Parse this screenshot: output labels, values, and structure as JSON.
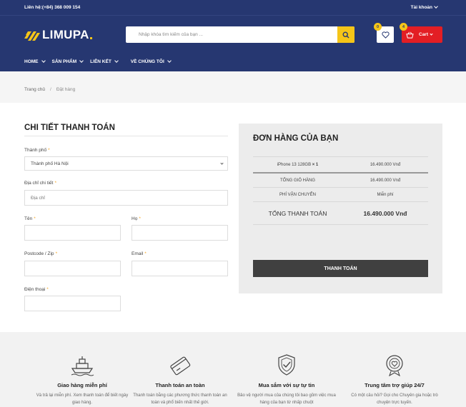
{
  "topbar": {
    "contact": "Liên hệ:(+84) 368 009 154",
    "account": "Tài khoản"
  },
  "header": {
    "logo_text": "LIMUPA",
    "search_placeholder": "Nhập khóa tìm kiếm của bạn ...",
    "wishlist_count": "0",
    "cart_count": "4",
    "cart_label": "Cart"
  },
  "nav": {
    "items": [
      {
        "label": "HOME"
      },
      {
        "label": "SẢN PHẨM"
      },
      {
        "label": "LIÊN KẾT"
      },
      {
        "label": "VỀ CHÚNG TÔI"
      }
    ]
  },
  "breadcrumb": {
    "home": "Trang chủ",
    "separator": "/",
    "current": "Đặt hàng"
  },
  "billing": {
    "title": "CHI TIẾT THANH TOÁN",
    "required_mark": "*",
    "city_label": "Thành phố",
    "city_value": "Thành phố Hà Nội",
    "address_label": "Địa chỉ chi tiết",
    "address_placeholder": "Địa chỉ",
    "first_name_label": "Tên",
    "last_name_label": "Họ",
    "postcode_label": "Postcode / Zip",
    "email_label": "Email",
    "phone_label": "Điện thoại"
  },
  "order": {
    "title": "ĐƠN HÀNG CỦA BẠN",
    "rows": [
      {
        "label": "iPhone 13 128GB",
        "qty": " × 1",
        "value": "16.490.000 Vnđ"
      },
      {
        "label": "TỔNG GIỎ HÀNG",
        "value": "16.490.000 Vnđ"
      },
      {
        "label": "PHÍ VẬN CHUYỂN",
        "value": "Miễn phí"
      }
    ],
    "total_label": "TỔNG THANH TOÁN",
    "total_value": "16.490.000 Vnđ",
    "pay_button": "THANH TOÁN"
  },
  "services": [
    {
      "title": "Giao hàng miễn phí",
      "desc": "Và trả lại miễn phí. Xem thanh toán để biết ngày giao hàng.",
      "icon": "ship-icon"
    },
    {
      "title": "Thanh toán an toàn",
      "desc": "Thanh toán bằng các phương thức thanh toán an toàn và phổ biến nhất thế giới.",
      "icon": "credit-card-icon"
    },
    {
      "title": "Mua sắm với sự tự tin",
      "desc": "Bảo vệ người mua của chúng tôi bao gồm việc mua hàng của bạn từ nhấp chuột",
      "icon": "shield-check-icon"
    },
    {
      "title": "Trung tâm trợ giúp 24/7",
      "desc": "Có một câu hỏi? Gọi cho Chuyên gia hoặc trò chuyện trực tuyến.",
      "icon": "support-heart-icon"
    }
  ],
  "colors": {
    "header_bg": "#263771",
    "accent_yellow": "#f5c518",
    "cart_red": "#e31e24",
    "pay_button_bg": "#404040"
  }
}
